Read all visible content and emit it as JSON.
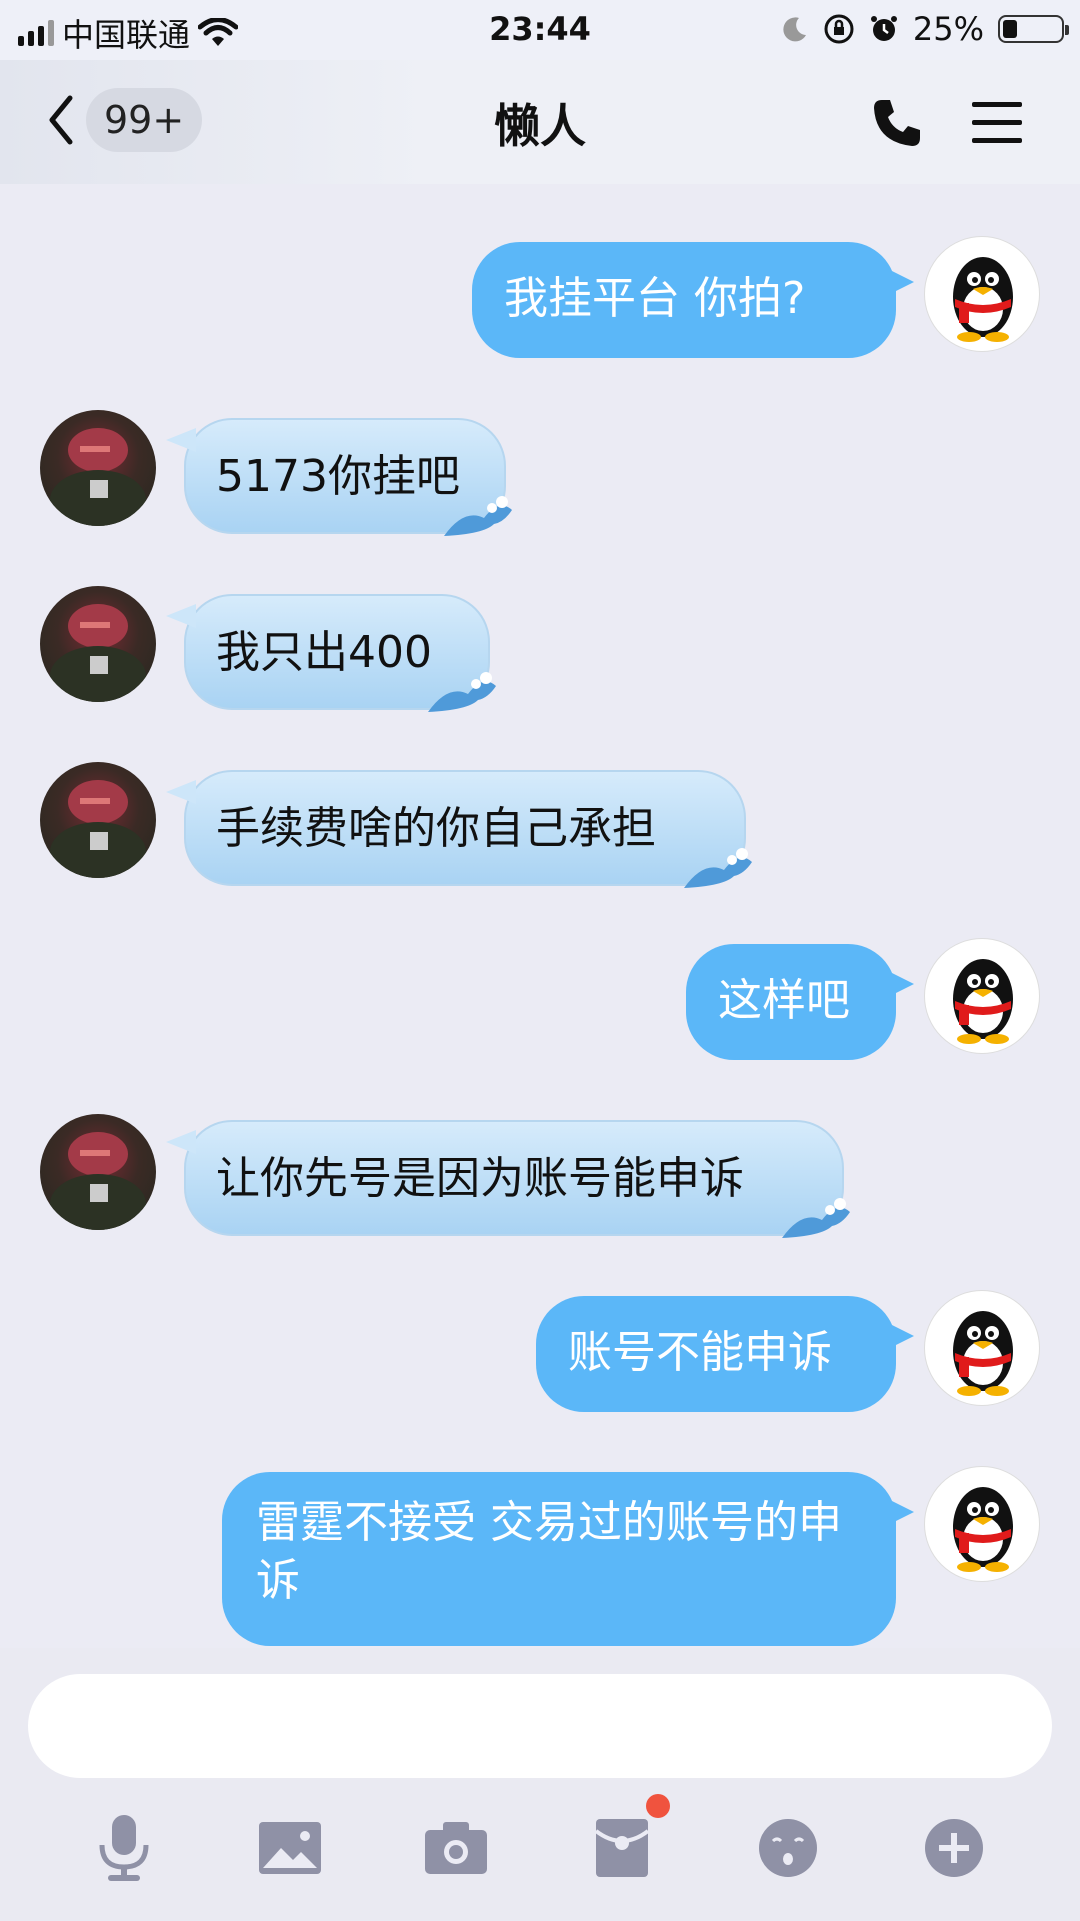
{
  "status": {
    "carrier": "中国联通",
    "time": "23:44",
    "battery": "25%",
    "battery_level": 0.25
  },
  "nav": {
    "unread_badge": "99+",
    "title": "懒人"
  },
  "messages": [
    {
      "from": "me",
      "text": "我挂平台 你拍?"
    },
    {
      "from": "them",
      "text": "5173你挂吧"
    },
    {
      "from": "them",
      "text": "我只出400"
    },
    {
      "from": "them",
      "text": "手续费啥的你自己承担"
    },
    {
      "from": "me",
      "text": "这样吧"
    },
    {
      "from": "them",
      "text": "让你先号是因为账号能申诉"
    },
    {
      "from": "me",
      "text": "账号不能申诉"
    },
    {
      "from": "me",
      "text": "雷霆不接受 交易过的账号的申诉"
    }
  ],
  "input": {
    "value": "",
    "placeholder": ""
  },
  "toolbar": [
    "mic-icon",
    "image-icon",
    "camera-icon",
    "red-packet-icon",
    "emoji-icon",
    "plus-icon"
  ],
  "colors": {
    "my_bubble": "#5bb7f8",
    "their_bubble": "#c4e1f8",
    "badge_dot": "#f0533e",
    "icon_gray": "#8f91a6"
  }
}
